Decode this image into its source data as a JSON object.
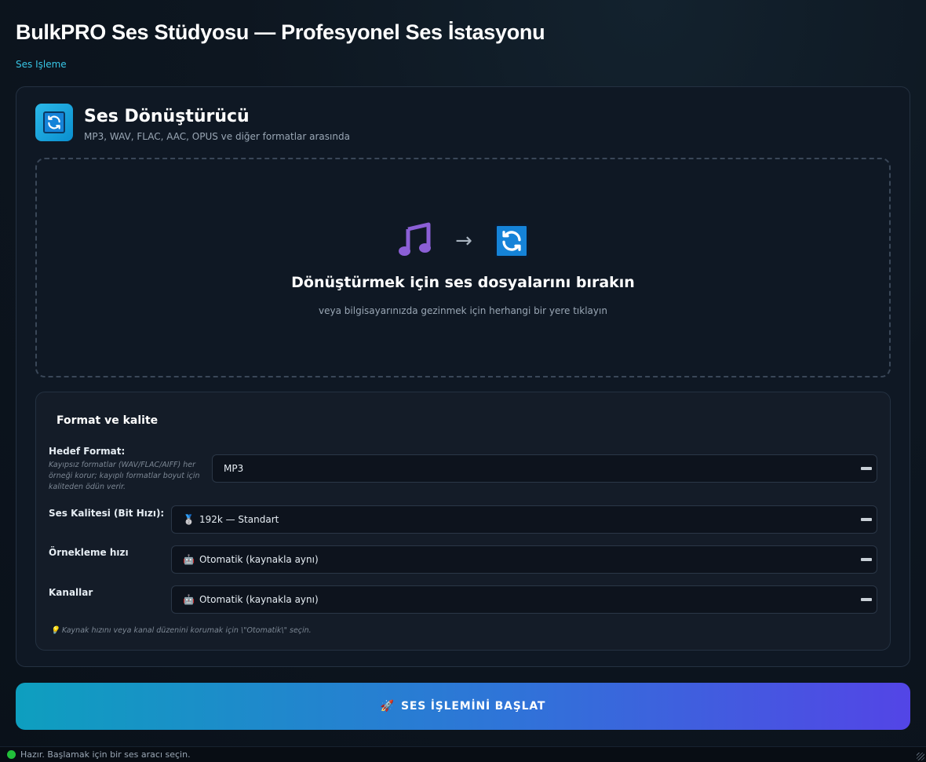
{
  "app": {
    "title": "BulkPRO Ses Stüdyosu — Profesyonel Ses İstasyonu",
    "breadcrumb": "Ses Işleme"
  },
  "tool": {
    "title": "Ses Dönüştürücü",
    "subtitle": "MP3, WAV, FLAC, AAC, OPUS ve diğer formatlar arasında",
    "icon": "sync-icon"
  },
  "dropzone": {
    "icons": [
      "music-note-icon",
      "arrow-right-icon",
      "sync-icon"
    ],
    "title": "Dönüştürmek için ses dosyalarını bırakın",
    "subtitle": "veya bilgisayarınızda gezinmek için herhangi bir yere tıklayın"
  },
  "settings": {
    "title": "Format ve kalite",
    "target_format": {
      "label": "Hedef Format:",
      "hint": "Kayıpsız formatlar (WAV/FLAC/AIFF) her örneği korur; kayıplı formatlar boyut için kaliteden ödün verir.",
      "value": "MP3"
    },
    "quality": {
      "label": "Ses Kalitesi (Bit Hızı):",
      "emoji": "🥈",
      "value": "192k — Standart"
    },
    "sample_rate": {
      "label": "Örnekleme hızı",
      "emoji": "🤖",
      "value": "Otomatik (kaynakla aynı)"
    },
    "channels": {
      "label": "Kanallar",
      "emoji": "🤖",
      "value": "Otomatik (kaynakla aynı)"
    },
    "footnote": "💡 Kaynak hızını veya kanal düzenini korumak için \\\"Otomatik\\\" seçin."
  },
  "start_button": {
    "icon": "🚀",
    "label": "SES İŞLEMİNİ BAŞLAT"
  },
  "status": {
    "text": "Hazır. Başlamak için bir ses aracı seçin.",
    "color": "#22c03a"
  },
  "colors": {
    "accent": "#38c6e6",
    "button_gradient": [
      "#0e9fbf",
      "#2f74d8",
      "#5345e6"
    ]
  }
}
